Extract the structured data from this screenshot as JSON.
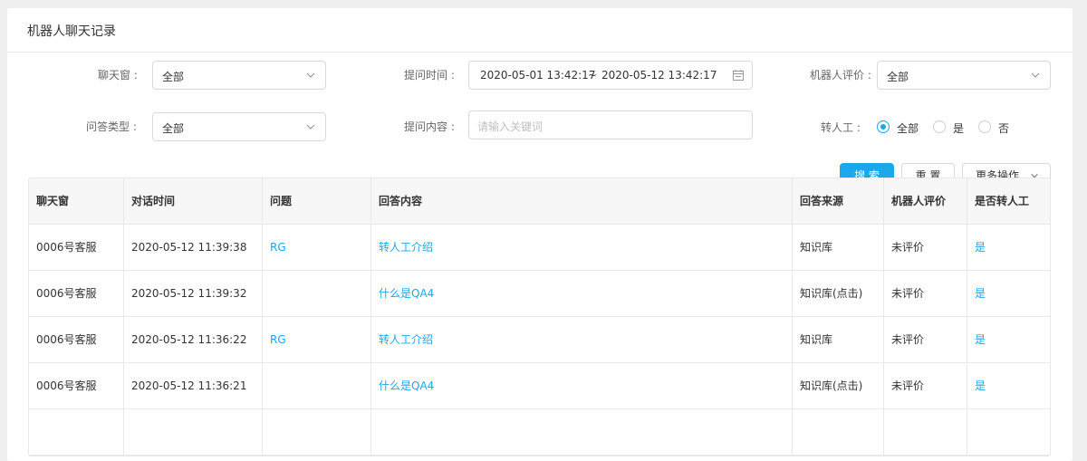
{
  "page": {
    "title": "机器人聊天记录"
  },
  "filters": {
    "chat_window": {
      "label": "聊天窗 :",
      "value": "全部"
    },
    "ask_time": {
      "label": "提问时间 :",
      "start": "2020-05-01 13:42:17",
      "separator": "~",
      "end": "2020-05-12 13:42:17"
    },
    "robot_rating": {
      "label": "机器人评价 :",
      "value": "全部"
    },
    "qa_type": {
      "label": "问答类型 :",
      "value": "全部"
    },
    "ask_content": {
      "label": "提问内容 :",
      "placeholder": "请输入关键词"
    },
    "transfer_human": {
      "label": "转人工 :",
      "options": [
        "全部",
        "是",
        "否"
      ],
      "selected": "全部"
    }
  },
  "buttons": {
    "search": "搜 索",
    "reset": "重 置",
    "more": "更多操作"
  },
  "table": {
    "headers": [
      "聊天窗",
      "对话时间",
      "问题",
      "回答内容",
      "回答来源",
      "机器人评价",
      "是否转人工"
    ],
    "rows": [
      [
        "0006号客服",
        "2020-05-12 11:39:38",
        "RG",
        "转人工介绍",
        "知识库",
        "未评价",
        "是"
      ],
      [
        "0006号客服",
        "2020-05-12 11:39:32",
        "",
        "什么是QA4",
        "知识库(点击)",
        "未评价",
        "是"
      ],
      [
        "0006号客服",
        "2020-05-12 11:36:22",
        "RG",
        "转人工介绍",
        "知识库",
        "未评价",
        "是"
      ],
      [
        "0006号客服",
        "2020-05-12 11:36:21",
        "",
        "什么是QA4",
        "知识库(点击)",
        "未评价",
        "是"
      ]
    ]
  },
  "colors": {
    "accent": "#1aa7ec",
    "border": "#d9d9d9",
    "header_bg": "#f7f7f7"
  },
  "icons": {
    "select_arrow": "chevron-down-icon",
    "date": "calendar-icon"
  }
}
